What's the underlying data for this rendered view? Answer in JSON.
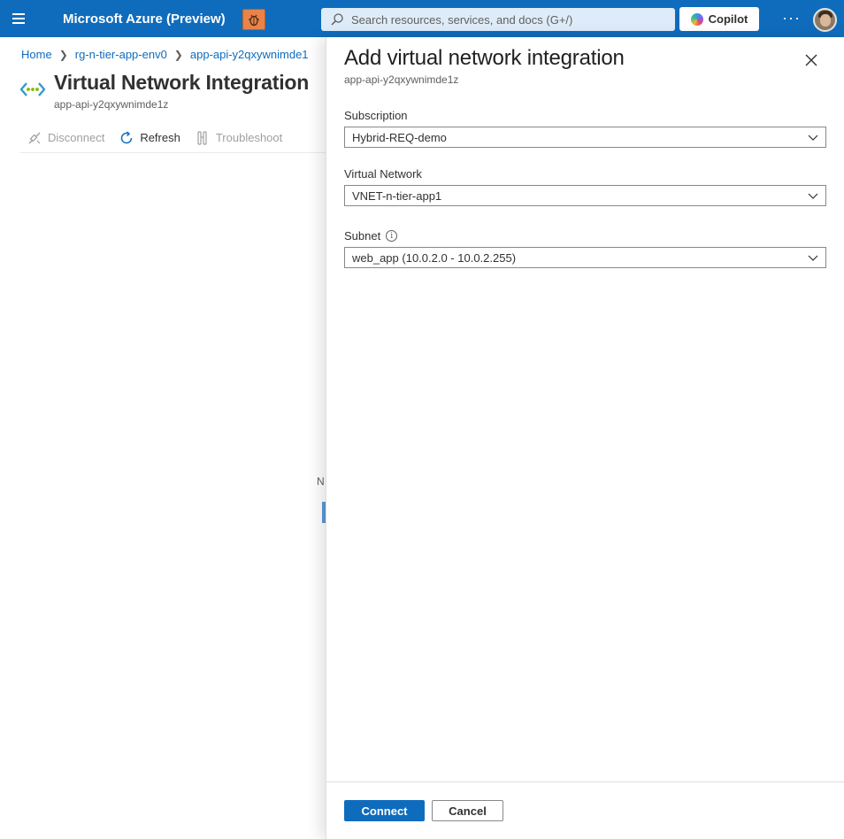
{
  "topbar": {
    "brand": "Microsoft Azure (Preview)",
    "search_placeholder": "Search resources, services, and docs (G+/)",
    "copilot_label": "Copilot",
    "more_label": "···",
    "brand_color": "#0f6cbd"
  },
  "breadcrumb": {
    "items": [
      "Home",
      "rg-n-tier-app-env0",
      "app-api-y2qxywnimde1"
    ]
  },
  "page": {
    "title": "Virtual Network Integration",
    "subtitle": "app-api-y2qxywnimde1z",
    "toolbar": {
      "disconnect": "Disconnect",
      "refresh": "Refresh",
      "troubleshoot": "Troubleshoot"
    },
    "fragment_text": "N"
  },
  "blade": {
    "title": "Add virtual network integration",
    "subtitle": "app-api-y2qxywnimde1z",
    "subscription": {
      "label": "Subscription",
      "value": "Hybrid-REQ-demo"
    },
    "virtual_network": {
      "label": "Virtual Network",
      "value": "VNET-n-tier-app1"
    },
    "subnet": {
      "label": "Subnet",
      "info_glyph": "i",
      "value": "web_app (10.0.2.0 - 10.0.2.255)"
    },
    "buttons": {
      "connect": "Connect",
      "cancel": "Cancel"
    }
  }
}
